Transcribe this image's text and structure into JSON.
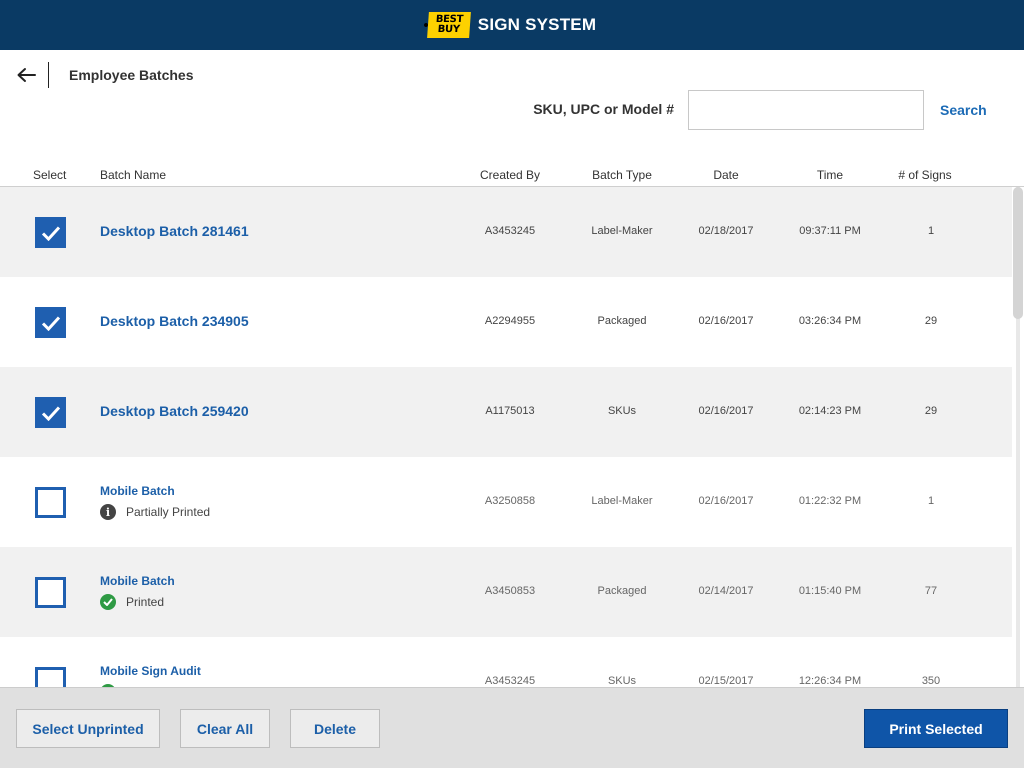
{
  "app": {
    "logo_line1": "BEST",
    "logo_line2": "BUY",
    "title": "SIGN SYSTEM"
  },
  "page": {
    "title": "Employee Batches"
  },
  "search": {
    "label": "SKU, UPC or Model #",
    "value": "",
    "placeholder": "",
    "button_label": "Search"
  },
  "columns": {
    "select": "Select",
    "batch_name": "Batch Name",
    "created_by": "Created By",
    "batch_type": "Batch Type",
    "date": "Date",
    "time": "Time",
    "num_signs": "# of Signs"
  },
  "rows": [
    {
      "checked": true,
      "name": "Desktop Batch 281461",
      "status": "",
      "status_icon": "",
      "created_by": "A3453245",
      "batch_type": "Label-Maker",
      "date": "02/18/2017",
      "time": "09:37:11 PM",
      "num_signs": "1"
    },
    {
      "checked": true,
      "name": "Desktop Batch 234905",
      "status": "",
      "status_icon": "",
      "created_by": "A2294955",
      "batch_type": "Packaged",
      "date": "02/16/2017",
      "time": "03:26:34 PM",
      "num_signs": "29"
    },
    {
      "checked": true,
      "name": "Desktop Batch 259420",
      "status": "",
      "status_icon": "",
      "created_by": "A1175013",
      "batch_type": "SKUs",
      "date": "02/16/2017",
      "time": "02:14:23 PM",
      "num_signs": "29"
    },
    {
      "checked": false,
      "name": "Mobile Batch",
      "status": "Partially Printed",
      "status_icon": "info-icon",
      "created_by": "A3250858",
      "batch_type": "Label-Maker",
      "date": "02/16/2017",
      "time": "01:22:32 PM",
      "num_signs": "1"
    },
    {
      "checked": false,
      "name": "Mobile Batch",
      "status": "Printed",
      "status_icon": "check-circle-icon",
      "created_by": "A3450853",
      "batch_type": "Packaged",
      "date": "02/14/2017",
      "time": "01:15:40 PM",
      "num_signs": "77"
    },
    {
      "checked": false,
      "name": "Mobile Sign Audit",
      "status": "",
      "status_icon": "check-circle-icon",
      "created_by": "A3453245",
      "batch_type": "SKUs",
      "date": "02/15/2017",
      "time": "12:26:34 PM",
      "num_signs": "350"
    }
  ],
  "footer": {
    "select_unprinted": "Select Unprinted",
    "clear_all": "Clear All",
    "delete": "Delete",
    "print_selected": "Print Selected"
  },
  "icons": {
    "back": "arrow-left-icon",
    "checkbox_checked": "checkmark-icon"
  },
  "colors": {
    "topbar": "#0a3a64",
    "accent": "#1f5fb0",
    "link": "#1c5fa8",
    "primary_button": "#0f55a8",
    "logo": "#fdd100",
    "printed": "#2e9a44"
  }
}
